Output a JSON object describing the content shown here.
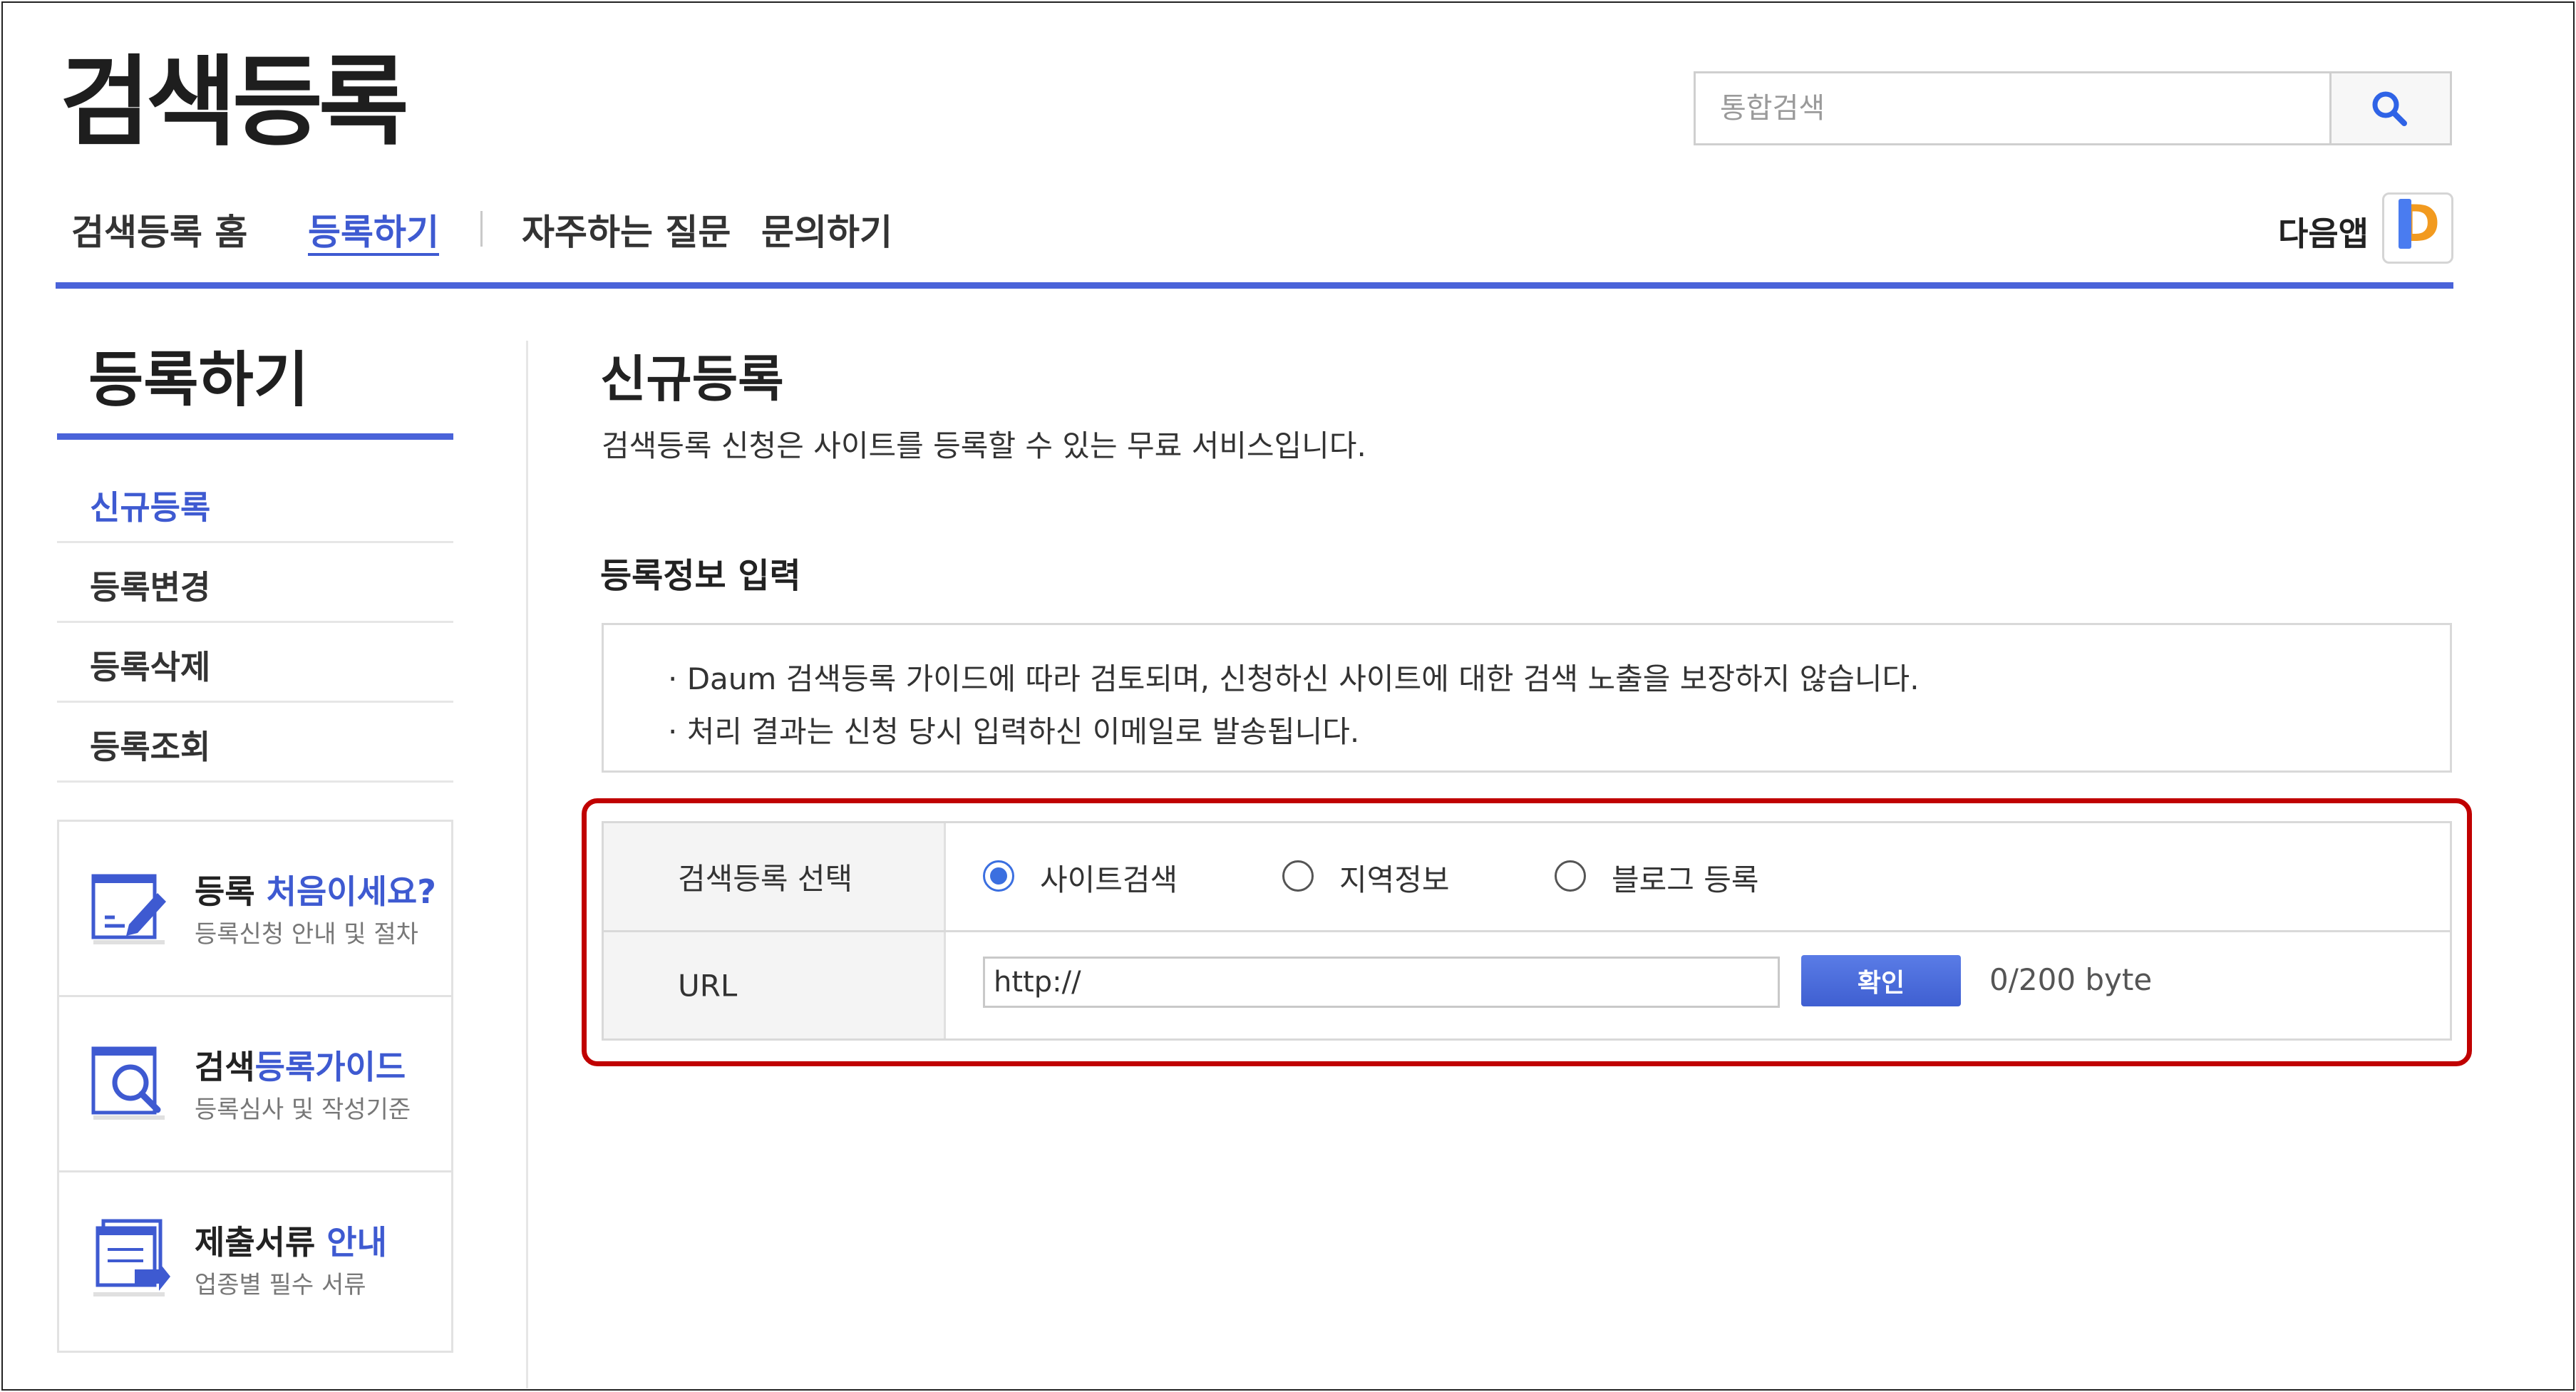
{
  "header": {
    "title": "검색등록",
    "search_placeholder": "통합검색",
    "search_icon": "search-icon"
  },
  "gnb": {
    "items": [
      {
        "label": "검색등록 홈"
      },
      {
        "label": "등록하기",
        "active": true
      },
      {
        "label": "자주하는 질문"
      },
      {
        "label": "문의하기"
      }
    ],
    "app_label": "다음앱",
    "app_icon": "daum-app-icon"
  },
  "sidebar": {
    "title": "등록하기",
    "items": [
      {
        "label": "신규등록",
        "active": true
      },
      {
        "label": "등록변경"
      },
      {
        "label": "등록삭제"
      },
      {
        "label": "등록조회"
      }
    ],
    "promos": [
      {
        "title_a": "등록 ",
        "title_b": "처음이세요?",
        "sub": "등록신청 안내 및 절차",
        "icon": "pencil-document-icon"
      },
      {
        "title_a": "검색",
        "title_b": "등록가이드",
        "sub": "등록심사 및 작성기준",
        "icon": "magnifier-guide-icon"
      },
      {
        "title_a": "제출서류 ",
        "title_b": "안내",
        "sub": "업종별 필수 서류",
        "icon": "document-stack-icon"
      }
    ]
  },
  "main": {
    "heading": "신규등록",
    "description": "검색등록 신청은 사이트를 등록할 수 있는 무료 서비스입니다.",
    "section_title": "등록정보 입력",
    "notices": [
      "· Daum 검색등록 가이드에 따라 검토되며, 신청하신 사이트에 대한 검색 노출을 보장하지 않습니다.",
      "· 처리 결과는 신청 당시 입력하신 이메일로 발송됩니다."
    ],
    "form": {
      "type_label": "검색등록 선택",
      "options": [
        {
          "label": "사이트검색",
          "checked": true
        },
        {
          "label": "지역정보",
          "checked": false
        },
        {
          "label": "블로그 등록",
          "checked": false
        }
      ],
      "url_label": "URL",
      "url_value": "http://",
      "confirm_label": "확인",
      "byte_count": "0/200 byte"
    }
  },
  "colors": {
    "accent": "#3e5ad1",
    "highlight_border": "#c00000"
  }
}
